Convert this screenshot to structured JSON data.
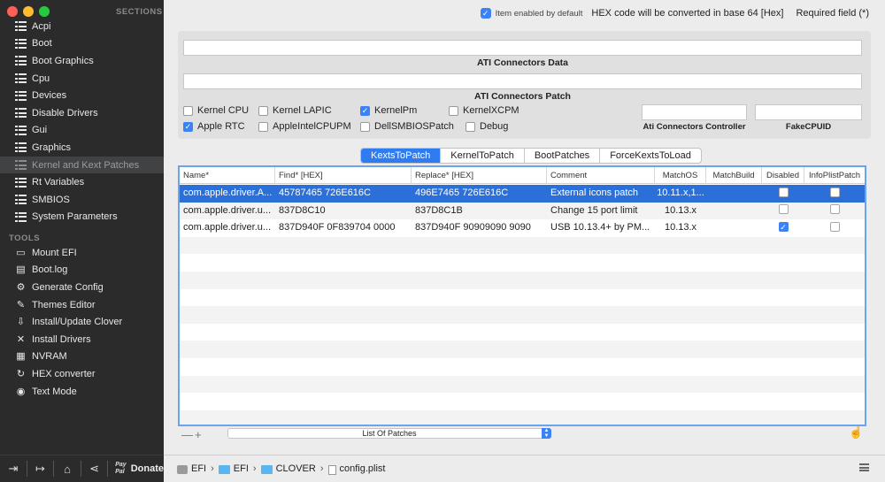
{
  "colors": {
    "accent": "#2f7bf0",
    "selection": "#2b6fd8",
    "sidebar_bg": "#2b2b2c",
    "close": "#ff5f57",
    "minimize": "#febc2e",
    "zoom": "#28c840"
  },
  "sidebar": {
    "sections_label": "SECTIONS",
    "sections": [
      {
        "label": "Acpi",
        "icon": "list-icon"
      },
      {
        "label": "Boot",
        "icon": "list-icon"
      },
      {
        "label": "Boot Graphics",
        "icon": "list-icon"
      },
      {
        "label": "Cpu",
        "icon": "list-icon"
      },
      {
        "label": "Devices",
        "icon": "list-icon"
      },
      {
        "label": "Disable Drivers",
        "icon": "list-icon"
      },
      {
        "label": "Gui",
        "icon": "list-icon"
      },
      {
        "label": "Graphics",
        "icon": "list-icon"
      },
      {
        "label": "Kernel and Kext Patches",
        "icon": "list-icon",
        "selected": true
      },
      {
        "label": "Rt Variables",
        "icon": "list-icon"
      },
      {
        "label": "SMBIOS",
        "icon": "list-icon"
      },
      {
        "label": "System Parameters",
        "icon": "list-icon"
      }
    ],
    "tools_label": "TOOLS",
    "tools": [
      {
        "label": "Mount EFI",
        "icon": "disk-icon"
      },
      {
        "label": "Boot.log",
        "icon": "log-icon"
      },
      {
        "label": "Generate Config",
        "icon": "gear-icon"
      },
      {
        "label": "Themes Editor",
        "icon": "brush-icon"
      },
      {
        "label": "Install/Update Clover",
        "icon": "download-icon"
      },
      {
        "label": "Install Drivers",
        "icon": "wrench-icon"
      },
      {
        "label": "NVRAM",
        "icon": "chip-icon"
      },
      {
        "label": "HEX converter",
        "icon": "refresh-icon"
      },
      {
        "label": "Text Mode",
        "icon": "eye-icon"
      }
    ],
    "bottom": {
      "paypal_line1": "Pay",
      "paypal_line2": "Pal",
      "donate": "Donate"
    }
  },
  "topbar": {
    "enabled_default": "Item enabled by default",
    "hex_note": "HEX code will be converted in base 64 [Hex]",
    "required": "Required field (*)"
  },
  "panel": {
    "ati_data_label": "ATI Connectors Data",
    "ati_patch_label": "ATI Connectors Patch",
    "ati_controller_label": "Ati Connectors Controller",
    "fake_cpuid_label": "FakeCPUID",
    "ati_data_value": "",
    "ati_patch_value": "",
    "ati_controller_value": "",
    "fake_cpuid_value": "",
    "checkboxes": {
      "kernel_cpu": {
        "label": "Kernel CPU",
        "checked": false
      },
      "kernel_lapic": {
        "label": "Kernel LAPIC",
        "checked": false
      },
      "kernel_pm": {
        "label": "KernelPm",
        "checked": true
      },
      "kernel_xcpm": {
        "label": "KernelXCPM",
        "checked": false
      },
      "apple_rtc": {
        "label": "Apple RTC",
        "checked": true
      },
      "apple_intel_cpupm": {
        "label": "AppleIntelCPUPM",
        "checked": false
      },
      "dell_smbios": {
        "label": "DellSMBIOSPatch",
        "checked": false
      },
      "debug": {
        "label": "Debug",
        "checked": false
      }
    }
  },
  "tabs": [
    {
      "label": "KextsToPatch",
      "active": true
    },
    {
      "label": "KernelToPatch"
    },
    {
      "label": "BootPatches"
    },
    {
      "label": "ForceKextsToLoad"
    }
  ],
  "table": {
    "columns": [
      "Name*",
      "Find* [HEX]",
      "Replace* [HEX]",
      "Comment",
      "MatchOS",
      "MatchBuild",
      "Disabled",
      "InfoPlistPatch"
    ],
    "rows": [
      {
        "name": "com.apple.driver.A...",
        "find": "45787465 726E616C",
        "replace": "496E7465 726E616C",
        "comment": "External icons patch",
        "matchos": "10.11.x,1...",
        "matchbuild": "",
        "disabled": false,
        "infoplist": false,
        "selected": true
      },
      {
        "name": "com.apple.driver.u...",
        "find": "837D8C10",
        "replace": "837D8C1B",
        "comment": "Change 15 port limit",
        "matchos": "10.13.x",
        "matchbuild": "",
        "disabled": false,
        "infoplist": false
      },
      {
        "name": "com.apple.driver.u...",
        "find": "837D940F 0F839704 0000",
        "replace": "837D940F 90909090 9090",
        "comment": "USB 10.13.4+ by PM...",
        "matchos": "10.13.x",
        "matchbuild": "",
        "disabled": true,
        "infoplist": false
      }
    ]
  },
  "bottom": {
    "plus_minus": "—+",
    "popup": "List Of Patches"
  },
  "pathbar": {
    "items": [
      "EFI",
      "EFI",
      "CLOVER",
      "config.plist"
    ]
  }
}
